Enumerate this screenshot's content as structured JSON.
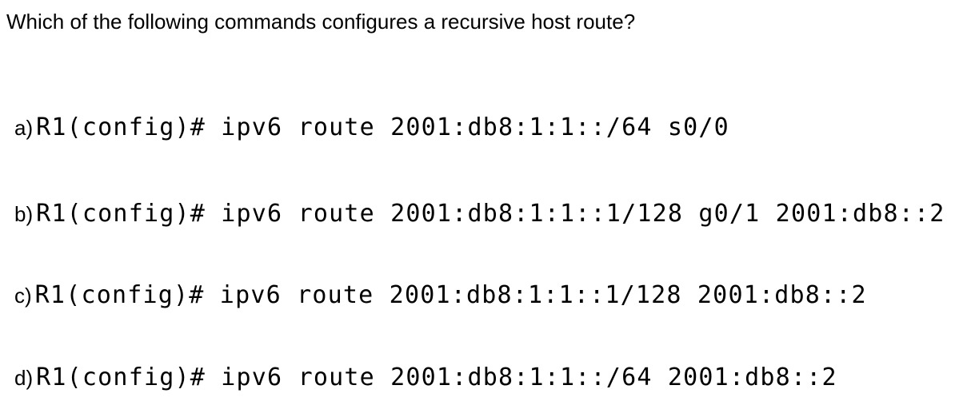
{
  "question": "Which of the following commands configures a recursive host route?",
  "options": [
    {
      "letter": "a)",
      "command": "R1(config)# ipv6 route 2001:db8:1:1::/64 s0/0"
    },
    {
      "letter": "b)",
      "command": "R1(config)# ipv6 route 2001:db8:1:1::1/128 g0/1 2001:db8::2"
    },
    {
      "letter": "c)",
      "command": "R1(config)# ipv6 route 2001:db8:1:1::1/128 2001:db8::2"
    },
    {
      "letter": "d)",
      "command": "R1(config)# ipv6 route 2001:db8:1:1::/64 2001:db8::2"
    }
  ]
}
